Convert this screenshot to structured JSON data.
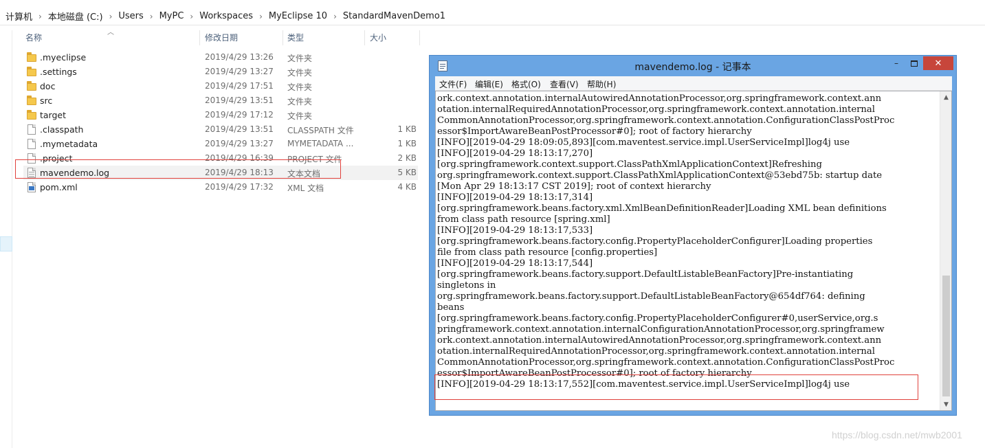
{
  "breadcrumb": {
    "segments": [
      "计算机",
      "本地磁盘 (C:)",
      "Users",
      "MyPC",
      "Workspaces",
      "MyEclipse 10",
      "StandardMavenDemo1"
    ],
    "separator": "›"
  },
  "columns": {
    "name": "名称",
    "date": "修改日期",
    "type": "类型",
    "size": "大小"
  },
  "files": [
    {
      "name": ".myeclipse",
      "date": "2019/4/29 13:26",
      "type": "文件夹",
      "size": "",
      "icon": "folder-icon"
    },
    {
      "name": ".settings",
      "date": "2019/4/29 13:27",
      "type": "文件夹",
      "size": "",
      "icon": "folder-icon"
    },
    {
      "name": "doc",
      "date": "2019/4/29 17:51",
      "type": "文件夹",
      "size": "",
      "icon": "folder-icon"
    },
    {
      "name": "src",
      "date": "2019/4/29 13:51",
      "type": "文件夹",
      "size": "",
      "icon": "folder-icon"
    },
    {
      "name": "target",
      "date": "2019/4/29 17:12",
      "type": "文件夹",
      "size": "",
      "icon": "folder-icon"
    },
    {
      "name": ".classpath",
      "date": "2019/4/29 13:51",
      "type": "CLASSPATH 文件",
      "size": "1 KB",
      "icon": "file-icon"
    },
    {
      "name": ".mymetadata",
      "date": "2019/4/29 13:27",
      "type": "MYMETADATA ...",
      "size": "1 KB",
      "icon": "file-icon"
    },
    {
      "name": ".project",
      "date": "2019/4/29 16:39",
      "type": "PROJECT 文件",
      "size": "2 KB",
      "icon": "file-icon"
    },
    {
      "name": "mavendemo.log",
      "date": "2019/4/29 18:13",
      "type": "文本文档",
      "size": "5 KB",
      "icon": "text-file-icon"
    },
    {
      "name": "pom.xml",
      "date": "2019/4/29 17:32",
      "type": "XML 文档",
      "size": "4 KB",
      "icon": "xml-file-icon"
    }
  ],
  "notepad": {
    "title": "mavendemo.log - 记事本",
    "window_buttons": {
      "minimize": "–",
      "close": "✕"
    },
    "menu": [
      "文件(F)",
      "编辑(E)",
      "格式(O)",
      "查看(V)",
      "帮助(H)"
    ],
    "lines": [
      "ork.context.annotation.internalAutowiredAnnotationProcessor,org.springframework.context.ann",
      "otation.internalRequiredAnnotationProcessor,org.springframework.context.annotation.internal",
      "CommonAnnotationProcessor,org.springframework.context.annotation.ConfigurationClassPostProc",
      "essor$ImportAwareBeanPostProcessor#0]; root of factory hierarchy",
      "[INFO][2019-04-29 18:09:05,893][com.maventest.service.impl.UserServiceImpl]log4j use",
      "[INFO][2019-04-29 18:13:17,270]",
      "[org.springframework.context.support.ClassPathXmlApplicationContext]Refreshing",
      "org.springframework.context.support.ClassPathXmlApplicationContext@53ebd75b: startup date",
      "[Mon Apr 29 18:13:17 CST 2019]; root of context hierarchy",
      "[INFO][2019-04-29 18:13:17,314]",
      "[org.springframework.beans.factory.xml.XmlBeanDefinitionReader]Loading XML bean definitions",
      "from class path resource [spring.xml]",
      "[INFO][2019-04-29 18:13:17,533]",
      "[org.springframework.beans.factory.config.PropertyPlaceholderConfigurer]Loading properties",
      "file from class path resource [config.properties]",
      "[INFO][2019-04-29 18:13:17,544]",
      "[org.springframework.beans.factory.support.DefaultListableBeanFactory]Pre-instantiating",
      "singletons in",
      "org.springframework.beans.factory.support.DefaultListableBeanFactory@654df764: defining",
      "beans",
      "[org.springframework.beans.factory.config.PropertyPlaceholderConfigurer#0,userService,org.s",
      "pringframework.context.annotation.internalConfigurationAnnotationProcessor,org.springframew",
      "ork.context.annotation.internalAutowiredAnnotationProcessor,org.springframework.context.ann",
      "otation.internalRequiredAnnotationProcessor,org.springframework.context.annotation.internal",
      "CommonAnnotationProcessor,org.springframework.context.annotation.ConfigurationClassPostProc",
      "essor$ImportAwareBeanPostProcessor#0]; root of factory hierarchy",
      "[INFO][2019-04-29 18:13:17,552][com.maventest.service.impl.UserServiceImpl]log4j use"
    ]
  },
  "watermark": "https://blog.csdn.net/mwb2001",
  "colors": {
    "notepad_frame": "#6aa5e3",
    "close_button": "#c7463b",
    "highlight": "#e0403b",
    "selected_row": "#f2f2f2"
  }
}
